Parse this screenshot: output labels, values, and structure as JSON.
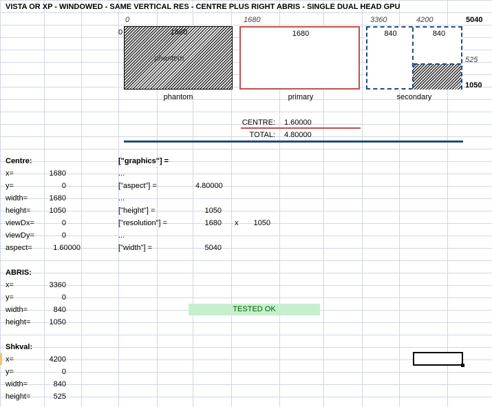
{
  "title": "VISTA OR XP - WINDOWED - SAME VERTICAL RES - CENTRE PLUS RIGHT ABRIS - SINGLE DUAL HEAD GPU",
  "diagram": {
    "axis_0": "0",
    "axis_1680": "1680",
    "axis_3360": "3360",
    "axis_4200": "4200",
    "axis_5040": "5040",
    "left_zero": "0",
    "phantom_width": "1680",
    "phantom_label": "phantom",
    "primary_width": "1680",
    "secondary_left_width": "840",
    "secondary_right_width": "840",
    "right_525": "525",
    "right_1050": "1050",
    "caption_phantom": "phantom",
    "caption_primary": "primary",
    "caption_secondary": "secondary"
  },
  "aspect_summary": {
    "centre_label": "CENTRE:",
    "centre_value": "1.60000",
    "total_label": "TOTAL:",
    "total_value": "4.80000"
  },
  "centre": {
    "heading": "Centre:",
    "rows": [
      {
        "label": "x=",
        "value": "1680"
      },
      {
        "label": "y=",
        "value": "0"
      },
      {
        "label": "width=",
        "value": "1680"
      },
      {
        "label": "height=",
        "value": "1050"
      },
      {
        "label": "viewDx=",
        "value": "0"
      },
      {
        "label": "viewDy=",
        "value": "0"
      },
      {
        "label": "aspect=",
        "value": "1.60000"
      }
    ]
  },
  "graphics": {
    "heading": "[\"graphics\"] =",
    "ellipsis": "...",
    "aspect_label": "[\"aspect\"] =",
    "aspect_value": "4.80000",
    "height_label": "[\"height\"] =",
    "height_value": "1050",
    "resolution_label": "[\"resolution\"] =",
    "resolution_w": "1680",
    "resolution_x": "x",
    "resolution_h": "1050",
    "width_label": "[\"width\"] =",
    "width_value": "5040"
  },
  "abris": {
    "heading": "ABRIS:",
    "rows": [
      {
        "label": "x=",
        "value": "3360"
      },
      {
        "label": "y=",
        "value": "0"
      },
      {
        "label": "width=",
        "value": "840"
      },
      {
        "label": "height=",
        "value": "1050"
      }
    ]
  },
  "shkval": {
    "heading": "Shkval:",
    "rows": [
      {
        "label": "x=",
        "value": "4200"
      },
      {
        "label": "y=",
        "value": "0"
      },
      {
        "label": "width=",
        "value": "840"
      },
      {
        "label": "height=",
        "value": "525"
      }
    ]
  },
  "status": {
    "tested": "TESTED OK"
  },
  "colors": {
    "gridline": "#d0d7e5",
    "primary_border": "#c0504d",
    "secondary_border": "#1f497d",
    "tested_fill": "#c6efce",
    "tested_text": "#006100"
  }
}
